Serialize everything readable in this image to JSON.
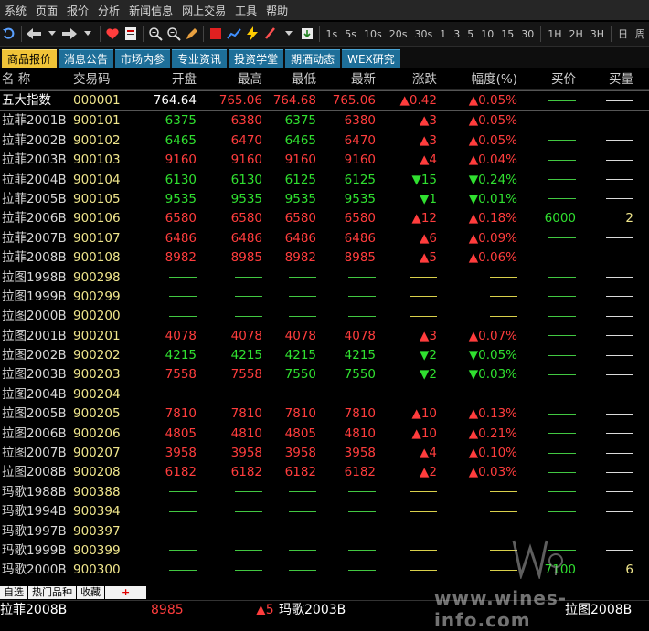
{
  "menu": [
    "系统",
    "页面",
    "报价",
    "分析",
    "新闻信息",
    "网上交易",
    "工具",
    "帮助"
  ],
  "toolbar": {
    "periods": [
      "1s",
      "5s",
      "10s",
      "20s",
      "30s",
      "1",
      "3",
      "5",
      "10",
      "15",
      "30",
      "1H",
      "2H",
      "3H",
      "日",
      "周"
    ]
  },
  "tabs": [
    {
      "label": "商品报价",
      "active": true
    },
    {
      "label": "消息公告",
      "active": false
    },
    {
      "label": "市场内参",
      "active": false
    },
    {
      "label": "专业资讯",
      "active": false
    },
    {
      "label": "投资学堂",
      "active": false
    },
    {
      "label": "期酒动态",
      "active": false
    },
    {
      "label": "WEX研究",
      "active": false
    }
  ],
  "columns": {
    "name": "名  称",
    "code": "交易码",
    "open": "开盘",
    "high": "最高",
    "low": "最低",
    "last": "最新",
    "chg": "涨跌",
    "pct": "幅度(%)",
    "bid": "买价",
    "vol": "买量"
  },
  "colors": {
    "up": "#ff3d3d",
    "down": "#30e030",
    "code": "#f0e68c",
    "accent": "#f0c438",
    "tab": "#1e6f99"
  },
  "rows": [
    {
      "name": "五大指数",
      "code": "000001",
      "open": "764.64",
      "high": "765.06",
      "low": "764.68",
      "last": "765.06",
      "chg": "▲0.42",
      "pct": "▲0.05%",
      "bid": "",
      "vol": "",
      "open_c": "white",
      "hl_c": "red",
      "chg_c": "red",
      "sel": true
    },
    {
      "name": "拉菲2001B",
      "code": "900101",
      "open": "6375",
      "high": "6380",
      "low": "6375",
      "last": "6380",
      "chg": "▲3",
      "pct": "▲0.05%",
      "bid": "",
      "vol": "",
      "open_c": "green",
      "high_c": "red",
      "low_c": "green",
      "last_c": "red",
      "chg_c": "red"
    },
    {
      "name": "拉菲2002B",
      "code": "900102",
      "open": "6465",
      "high": "6470",
      "low": "6465",
      "last": "6470",
      "chg": "▲3",
      "pct": "▲0.05%",
      "bid": "",
      "vol": "",
      "open_c": "green",
      "high_c": "red",
      "low_c": "green",
      "last_c": "red",
      "chg_c": "red"
    },
    {
      "name": "拉菲2003B",
      "code": "900103",
      "open": "9160",
      "high": "9160",
      "low": "9160",
      "last": "9160",
      "chg": "▲4",
      "pct": "▲0.04%",
      "bid": "",
      "vol": "",
      "open_c": "red",
      "high_c": "red",
      "low_c": "red",
      "last_c": "red",
      "chg_c": "red"
    },
    {
      "name": "拉菲2004B",
      "code": "900104",
      "open": "6130",
      "high": "6130",
      "low": "6125",
      "last": "6125",
      "chg": "▼15",
      "pct": "▼0.24%",
      "bid": "",
      "vol": "",
      "open_c": "green",
      "high_c": "green",
      "low_c": "green",
      "last_c": "green",
      "chg_c": "green"
    },
    {
      "name": "拉菲2005B",
      "code": "900105",
      "open": "9535",
      "high": "9535",
      "low": "9535",
      "last": "9535",
      "chg": "▼1",
      "pct": "▼0.01%",
      "bid": "",
      "vol": "",
      "open_c": "green",
      "high_c": "green",
      "low_c": "green",
      "last_c": "green",
      "chg_c": "green"
    },
    {
      "name": "拉菲2006B",
      "code": "900106",
      "open": "6580",
      "high": "6580",
      "low": "6580",
      "last": "6580",
      "chg": "▲12",
      "pct": "▲0.18%",
      "bid": "6000",
      "vol": "2",
      "open_c": "red",
      "high_c": "red",
      "low_c": "red",
      "last_c": "red",
      "chg_c": "red",
      "bid_c": "green",
      "vol_c": "yellowv"
    },
    {
      "name": "拉菲2007B",
      "code": "900107",
      "open": "6486",
      "high": "6486",
      "low": "6486",
      "last": "6486",
      "chg": "▲6",
      "pct": "▲0.09%",
      "bid": "",
      "vol": "",
      "open_c": "red",
      "high_c": "red",
      "low_c": "red",
      "last_c": "red",
      "chg_c": "red"
    },
    {
      "name": "拉菲2008B",
      "code": "900108",
      "open": "8982",
      "high": "8985",
      "low": "8982",
      "last": "8985",
      "chg": "▲5",
      "pct": "▲0.06%",
      "bid": "",
      "vol": "",
      "open_c": "red",
      "high_c": "red",
      "low_c": "red",
      "last_c": "red",
      "chg_c": "red"
    },
    {
      "name": "拉图1998B",
      "code": "900298",
      "open": "",
      "high": "",
      "low": "",
      "last": "",
      "chg": "",
      "pct": "",
      "bid": "",
      "vol": ""
    },
    {
      "name": "拉图1999B",
      "code": "900299",
      "open": "",
      "high": "",
      "low": "",
      "last": "",
      "chg": "",
      "pct": "",
      "bid": "",
      "vol": ""
    },
    {
      "name": "拉图2000B",
      "code": "900200",
      "open": "",
      "high": "",
      "low": "",
      "last": "",
      "chg": "",
      "pct": "",
      "bid": "",
      "vol": ""
    },
    {
      "name": "拉图2001B",
      "code": "900201",
      "open": "4078",
      "high": "4078",
      "low": "4078",
      "last": "4078",
      "chg": "▲3",
      "pct": "▲0.07%",
      "bid": "",
      "vol": "",
      "open_c": "red",
      "high_c": "red",
      "low_c": "red",
      "last_c": "red",
      "chg_c": "red"
    },
    {
      "name": "拉图2002B",
      "code": "900202",
      "open": "4215",
      "high": "4215",
      "low": "4215",
      "last": "4215",
      "chg": "▼2",
      "pct": "▼0.05%",
      "bid": "",
      "vol": "",
      "open_c": "green",
      "high_c": "green",
      "low_c": "green",
      "last_c": "green",
      "chg_c": "green"
    },
    {
      "name": "拉图2003B",
      "code": "900203",
      "open": "7558",
      "high": "7558",
      "low": "7550",
      "last": "7550",
      "chg": "▼2",
      "pct": "▼0.03%",
      "bid": "",
      "vol": "",
      "open_c": "red",
      "high_c": "red",
      "low_c": "green",
      "last_c": "green",
      "chg_c": "green"
    },
    {
      "name": "拉图2004B",
      "code": "900204",
      "open": "",
      "high": "",
      "low": "",
      "last": "",
      "chg": "",
      "pct": "",
      "bid": "",
      "vol": ""
    },
    {
      "name": "拉图2005B",
      "code": "900205",
      "open": "7810",
      "high": "7810",
      "low": "7810",
      "last": "7810",
      "chg": "▲10",
      "pct": "▲0.13%",
      "bid": "",
      "vol": "",
      "open_c": "red",
      "high_c": "red",
      "low_c": "red",
      "last_c": "red",
      "chg_c": "red"
    },
    {
      "name": "拉图2006B",
      "code": "900206",
      "open": "4805",
      "high": "4810",
      "low": "4805",
      "last": "4810",
      "chg": "▲10",
      "pct": "▲0.21%",
      "bid": "",
      "vol": "",
      "open_c": "red",
      "high_c": "red",
      "low_c": "red",
      "last_c": "red",
      "chg_c": "red"
    },
    {
      "name": "拉图2007B",
      "code": "900207",
      "open": "3958",
      "high": "3958",
      "low": "3958",
      "last": "3958",
      "chg": "▲4",
      "pct": "▲0.10%",
      "bid": "",
      "vol": "",
      "open_c": "red",
      "high_c": "red",
      "low_c": "red",
      "last_c": "red",
      "chg_c": "red"
    },
    {
      "name": "拉图2008B",
      "code": "900208",
      "open": "6182",
      "high": "6182",
      "low": "6182",
      "last": "6182",
      "chg": "▲2",
      "pct": "▲0.03%",
      "bid": "",
      "vol": "",
      "open_c": "red",
      "high_c": "red",
      "low_c": "red",
      "last_c": "red",
      "chg_c": "red"
    },
    {
      "name": "玛歌1988B",
      "code": "900388",
      "open": "",
      "high": "",
      "low": "",
      "last": "",
      "chg": "",
      "pct": "",
      "bid": "",
      "vol": ""
    },
    {
      "name": "玛歌1994B",
      "code": "900394",
      "open": "",
      "high": "",
      "low": "",
      "last": "",
      "chg": "",
      "pct": "",
      "bid": "",
      "vol": ""
    },
    {
      "name": "玛歌1997B",
      "code": "900397",
      "open": "",
      "high": "",
      "low": "",
      "last": "",
      "chg": "",
      "pct": "",
      "bid": "",
      "vol": ""
    },
    {
      "name": "玛歌1999B",
      "code": "900399",
      "open": "",
      "high": "",
      "low": "",
      "last": "",
      "chg": "",
      "pct": "",
      "bid": "",
      "vol": ""
    },
    {
      "name": "玛歌2000B",
      "code": "900300",
      "open": "",
      "high": "",
      "low": "",
      "last": "",
      "chg": "",
      "pct": "",
      "bid": "7100",
      "vol": "6",
      "bid_c": "green",
      "vol_c": "yellowv"
    }
  ],
  "bottom_tabs": [
    "自选",
    "热门品种",
    "收藏",
    "+"
  ],
  "ticker": [
    {
      "text": "拉菲2008B",
      "color": "#ffffff"
    },
    {
      "text": "8985",
      "color": "#ff3d3d"
    },
    {
      "text": "▲5",
      "color": "#ff3d3d"
    },
    {
      "text": "玛歌2003B",
      "color": "#ffffff"
    },
    {
      "text": "拉图2008B",
      "color": "#ffffff"
    }
  ],
  "watermark": "www.wines-info.com"
}
